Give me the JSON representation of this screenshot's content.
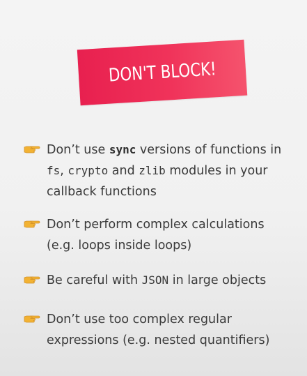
{
  "banner": {
    "title": "DON'T BLOCK!",
    "color": "#ee2f58"
  },
  "bullet_icon": "pointing-hand-icon",
  "bullet_color": "#f2b233",
  "tips": [
    {
      "parts": [
        {
          "text": "Don’t use ",
          "style": "normal"
        },
        {
          "text": "sync",
          "style": "code-bold"
        },
        {
          "text": " versions of functions in",
          "style": "normal"
        },
        {
          "text": "fs",
          "style": "code"
        },
        {
          "text": ", ",
          "style": "normal"
        },
        {
          "text": "crypto",
          "style": "code"
        },
        {
          "text": " and ",
          "style": "normal"
        },
        {
          "text": "zlib",
          "style": "code"
        },
        {
          "text": " modules in your",
          "style": "normal"
        },
        {
          "text": "callback functions",
          "style": "normal"
        }
      ]
    },
    {
      "parts": [
        {
          "text": "Don’t perform complex calculations",
          "style": "normal"
        },
        {
          "text": "(e.g. loops inside loops)",
          "style": "normal"
        }
      ]
    },
    {
      "parts": [
        {
          "text": "Be careful with ",
          "style": "normal"
        },
        {
          "text": "JSON",
          "style": "code"
        },
        {
          "text": " in large objects",
          "style": "normal"
        }
      ]
    },
    {
      "parts": [
        {
          "text": "Don’t use too complex regular",
          "style": "normal"
        },
        {
          "text": "expressions (e.g. nested quantifiers)",
          "style": "normal"
        }
      ]
    }
  ]
}
